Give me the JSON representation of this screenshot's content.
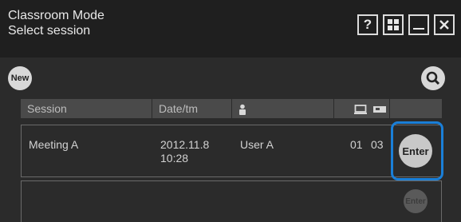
{
  "title": {
    "app_name": "Classroom Mode",
    "subtitle": "Select session"
  },
  "window_buttons": {
    "help_label": "?"
  },
  "toolbar": {
    "new_label": "New"
  },
  "table": {
    "columns": [
      {
        "label": "Session"
      },
      {
        "label": "Date/tm"
      },
      {
        "label": "",
        "icon": "person-icon"
      },
      {
        "label": "",
        "icon": "computer-icon"
      },
      {
        "label": "",
        "icon": "projector-icon"
      }
    ],
    "rows": [
      {
        "session": "Meeting A",
        "date": "2012.11.8",
        "time": "10:28",
        "user": "User A",
        "computers": "01",
        "projectors": "03",
        "enter_label": "Enter"
      }
    ],
    "empty_row_enter_label": "Enter"
  },
  "colors": {
    "background": "#2b2b2b",
    "titlebar": "#1f1f1f",
    "header_cell": "#4a4a4a",
    "highlight": "#1a7fd8"
  }
}
